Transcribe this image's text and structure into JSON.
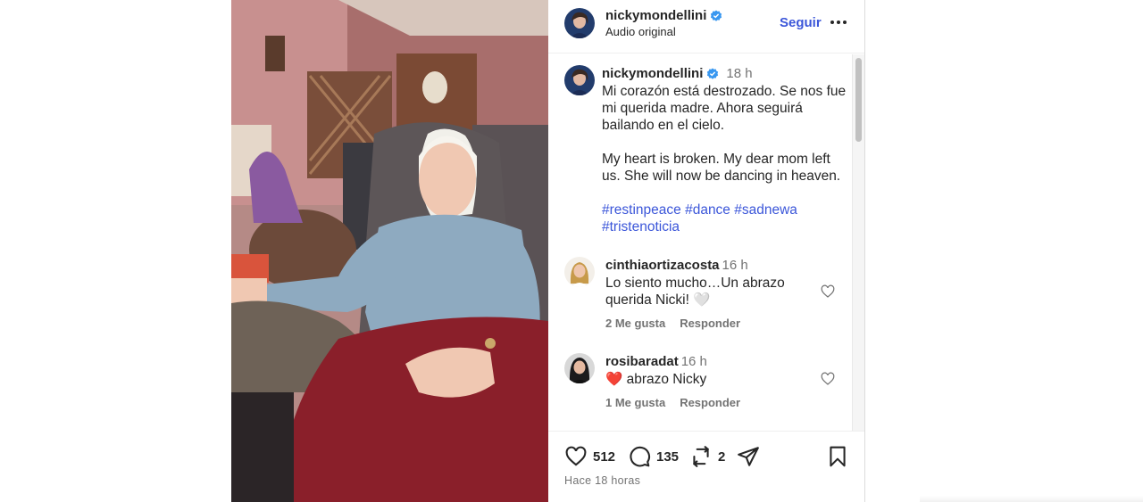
{
  "post": {
    "username": "nickymondellini",
    "audio": "Audio original",
    "follow_label": "Seguir",
    "caption_time": "18 h",
    "caption_es": "Mi corazón está destrozado. Se nos fue mi querida madre. Ahora seguirá bailando en el cielo.",
    "caption_en": "My heart is broken. My dear mom left us. She will now be dancing in heaven.",
    "hashtags": [
      "#restinpeace",
      "#dance",
      "#sadnewa",
      "#tristenoticia"
    ]
  },
  "comments": [
    {
      "username": "cinthiaortizacosta",
      "time": "16 h",
      "text": "Lo siento mucho…Un abrazo querida Nicki! 🤍",
      "likes": "2 Me gusta",
      "reply": "Responder"
    },
    {
      "username": "rosibaradat",
      "time": "16 h",
      "text": "❤️ abrazo Nicky",
      "likes": "1 Me gusta",
      "reply": "Responder"
    }
  ],
  "actions": {
    "likes": "512",
    "comments": "135",
    "reposts": "2",
    "posted": "Hace 18 horas"
  },
  "colors": {
    "link": "#3b56d9",
    "verified": "#3897f0",
    "muted": "#737373"
  }
}
